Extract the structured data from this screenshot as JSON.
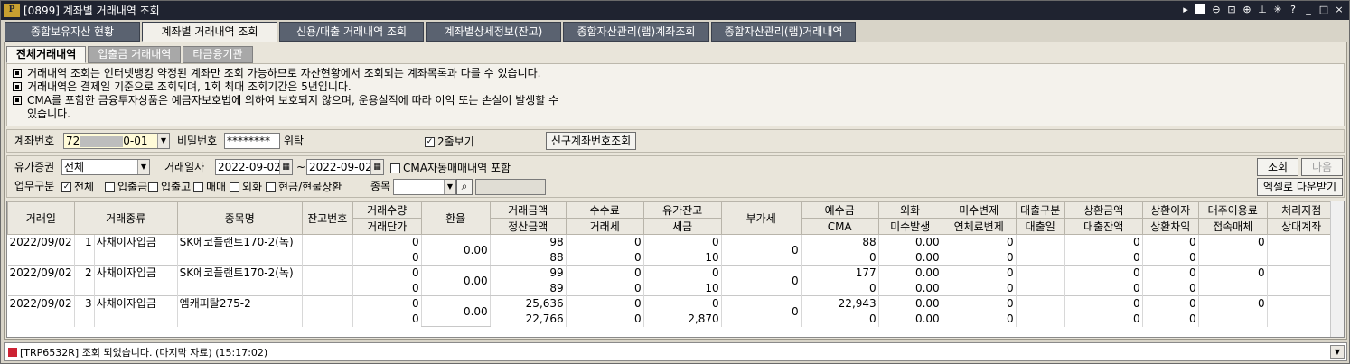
{
  "window": {
    "logo": "P",
    "title": "[0899] 계좌별 거래내역 조회",
    "icons": [
      "menu-arrow-icon",
      "one-box-icon",
      "zoom-out-icon",
      "fit-icon",
      "zoom-in-icon",
      "pin-icon",
      "settings-icon",
      "help-icon",
      "minimize-icon",
      "maximize-icon",
      "close-icon"
    ],
    "icon_glyphs": [
      "▸",
      "1",
      "⊖",
      "⊡",
      "⊕",
      "⊥",
      "✳",
      "?",
      "_",
      "□",
      "×"
    ]
  },
  "main_tabs": [
    "종합보유자산 현황",
    "계좌별 거래내역 조회",
    "신용/대출 거래내역 조회",
    "계좌별상세정보(잔고)",
    "종합자산관리(랩)계좌조회",
    "종합자산관리(랩)거래내역"
  ],
  "sub_tabs": [
    "전체거래내역",
    "입출금 거래내역",
    "타금융기관"
  ],
  "notices": [
    "거래내역 조회는 인터넷뱅킹 약정된 계좌만 조회 가능하므로 자산현황에서 조회되는 계좌목록과 다를 수 있습니다.",
    "거래내역은 결제일 기준으로 조회되며, 1회 최대 조회기간은 5년입니다.",
    "CMA를 포함한 금융투자상품은 예금자보호법에 의하여 보호되지 않으며, 운용실적에 따라 이익 또는 손실이 발생할 수"
  ],
  "notice_cont": "있습니다.",
  "account": {
    "label": "계좌번호",
    "prefix": "72",
    "suffix": "0-01",
    "pw_label": "비밀번호",
    "pw_value": "********",
    "trust_label": "위탁",
    "double_view_label": "2줄보기",
    "double_view_checked": "✓",
    "new_acct_button": "신구계좌번호조회"
  },
  "filter": {
    "sec_label": "유가증권",
    "sec_value": "전체",
    "date_label": "거래일자",
    "date_from": "2022-09-02",
    "tilde": "~",
    "date_to": "2022-09-02",
    "cma_label": "CMA자동매매내역 포함",
    "biz_label": "업무구분",
    "types": [
      {
        "label": "전체",
        "checked": "✓"
      },
      {
        "label": "입출금",
        "checked": ""
      },
      {
        "label": "입출고",
        "checked": ""
      },
      {
        "label": "매매",
        "checked": ""
      },
      {
        "label": "외화",
        "checked": ""
      },
      {
        "label": "현금/현물상환",
        "checked": ""
      }
    ],
    "item_label": "종목",
    "search_button": "조회",
    "next_button": "다음",
    "excel_button": "엑셀로 다운받기"
  },
  "table": {
    "headers_row1": [
      "거래일",
      "거래종류",
      "종목명",
      "잔고번호",
      "거래수량",
      "환율",
      "거래금액",
      "수수료",
      "유가잔고",
      "부가세",
      "예수금",
      "외화",
      "미수변제",
      "대출구분",
      "상환금액",
      "상환이자",
      "대주이용료",
      "처리지점"
    ],
    "headers_row2": [
      "",
      "",
      "",
      "",
      "거래단가",
      "",
      "정산금액",
      "거래세",
      "세금",
      "",
      "CMA",
      "미수발생",
      "연체료변제",
      "대출일",
      "대출잔액",
      "상환차익",
      "접속매체",
      "상대계좌"
    ],
    "records": [
      {
        "date": "2022/09/02",
        "no": "1",
        "type": "사채이자입금",
        "item": "SK에코플랜트170-2(녹)",
        "balance_no": "",
        "qty": "0",
        "price": "0",
        "fx": "0.00",
        "amount": "98",
        "settle": "88",
        "fee": "0",
        "tx_tax": "0",
        "sec_bal": "0",
        "tax": "10",
        "vat": "0",
        "deposit": "88",
        "cma": "0",
        "fx1": "0.00",
        "fx2": "0.00",
        "repay": "0",
        "late": "0",
        "loan_type": "",
        "loan_date": "",
        "repay_amt": "0",
        "loan_bal": "0",
        "repay_int": "0",
        "repay_gain": "0",
        "lend_fee": "0",
        "media": "",
        "branch": "",
        "cp_acct": ""
      },
      {
        "date": "2022/09/02",
        "no": "2",
        "type": "사채이자입금",
        "item": "SK에코플랜트170-2(녹)",
        "balance_no": "",
        "qty": "0",
        "price": "0",
        "fx": "0.00",
        "amount": "99",
        "settle": "89",
        "fee": "0",
        "tx_tax": "0",
        "sec_bal": "0",
        "tax": "10",
        "vat": "0",
        "deposit": "177",
        "cma": "0",
        "fx1": "0.00",
        "fx2": "0.00",
        "repay": "0",
        "late": "0",
        "loan_type": "",
        "loan_date": "",
        "repay_amt": "0",
        "loan_bal": "0",
        "repay_int": "0",
        "repay_gain": "0",
        "lend_fee": "0",
        "media": "",
        "branch": "",
        "cp_acct": ""
      },
      {
        "date": "2022/09/02",
        "no": "3",
        "type": "사채이자입금",
        "item": "엠캐피탈275-2",
        "balance_no": "",
        "qty": "0",
        "price": "0",
        "fx": "0.00",
        "amount": "25,636",
        "settle": "22,766",
        "fee": "0",
        "tx_tax": "0",
        "sec_bal": "0",
        "tax": "2,870",
        "vat": "0",
        "deposit": "22,943",
        "cma": "0",
        "fx1": "0.00",
        "fx2": "0.00",
        "repay": "0",
        "late": "0",
        "loan_type": "",
        "loan_date": "",
        "repay_amt": "0",
        "loan_bal": "0",
        "repay_int": "0",
        "repay_gain": "0",
        "lend_fee": "0",
        "media": "",
        "branch": "",
        "cp_acct": ""
      }
    ]
  },
  "status": {
    "message": "[TRP6532R] 조회 되었습니다. (마지막 자료) (15:17:02)"
  }
}
